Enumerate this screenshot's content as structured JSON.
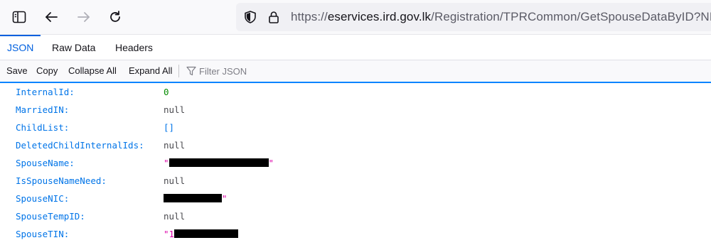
{
  "browser": {
    "url_prefix": "https://",
    "url_host": "eservices.ird.gov.lk",
    "url_path": "/Registration/TPRCommon/GetSpouseDataByID?NIC"
  },
  "viewer": {
    "tabs": [
      "JSON",
      "Raw Data",
      "Headers"
    ],
    "active_tab": "JSON",
    "toolbar": {
      "save": "Save",
      "copy": "Copy",
      "collapse_all": "Collapse All",
      "expand_all": "Expand All",
      "filter_placeholder": "Filter JSON"
    }
  },
  "json_rows": [
    {
      "key": "InternalId:",
      "value": "0",
      "type": "number"
    },
    {
      "key": "MarriedIN:",
      "value": "null",
      "type": "null"
    },
    {
      "key": "ChildList:",
      "value": "[]",
      "type": "array"
    },
    {
      "key": "DeletedChildInternalIds:",
      "value": "null",
      "type": "null"
    },
    {
      "key": "SpouseName:",
      "value": "\"",
      "type": "string-redacted",
      "suffix": "\""
    },
    {
      "key": "IsSpouseNameNeed:",
      "value": "null",
      "type": "null"
    },
    {
      "key": "SpouseNIC:",
      "value": "",
      "type": "string-redacted",
      "suffix": "\""
    },
    {
      "key": "SpouseTempID:",
      "value": "null",
      "type": "null"
    },
    {
      "key": "SpouseTIN:",
      "value": "\"1",
      "type": "string-redacted",
      "suffix": ""
    }
  ],
  "colors": {
    "key": "#0074e8",
    "number": "#058b00",
    "string": "#dd00a9",
    "accent": "#0060df"
  },
  "icons": [
    "sidebar-icon",
    "back-arrow-icon",
    "forward-arrow-icon",
    "reload-icon",
    "shield-icon",
    "lock-icon",
    "filter-icon"
  ]
}
